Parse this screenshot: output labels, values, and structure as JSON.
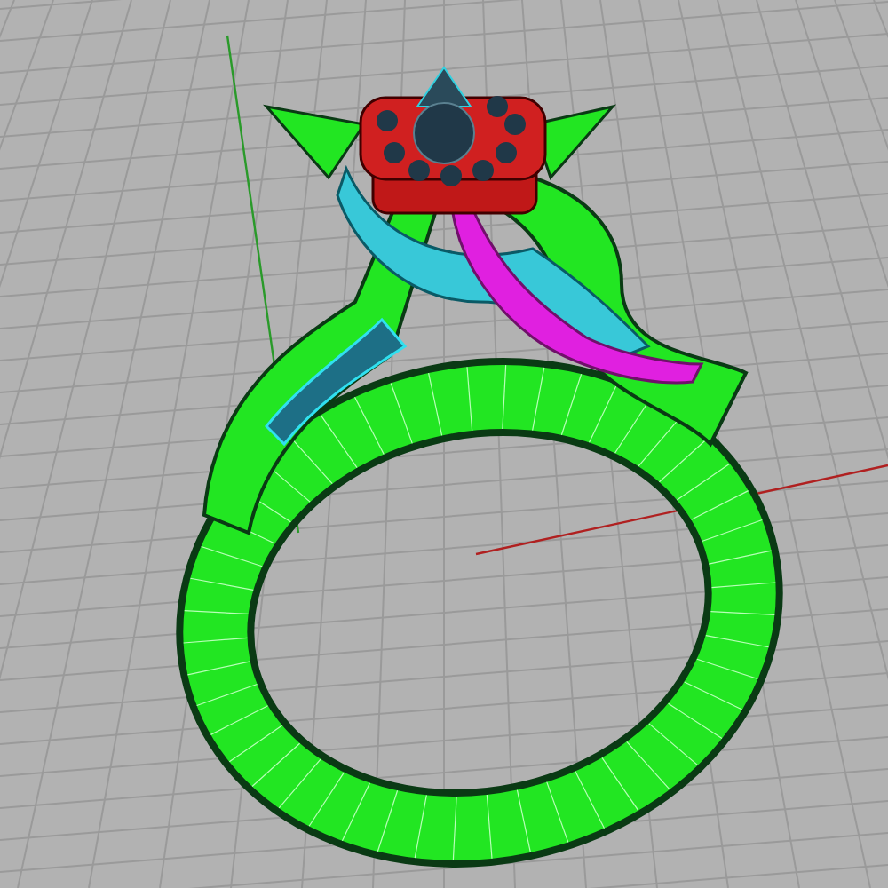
{
  "viewport": {
    "shows_grid": true,
    "shows_axes": true
  }
}
